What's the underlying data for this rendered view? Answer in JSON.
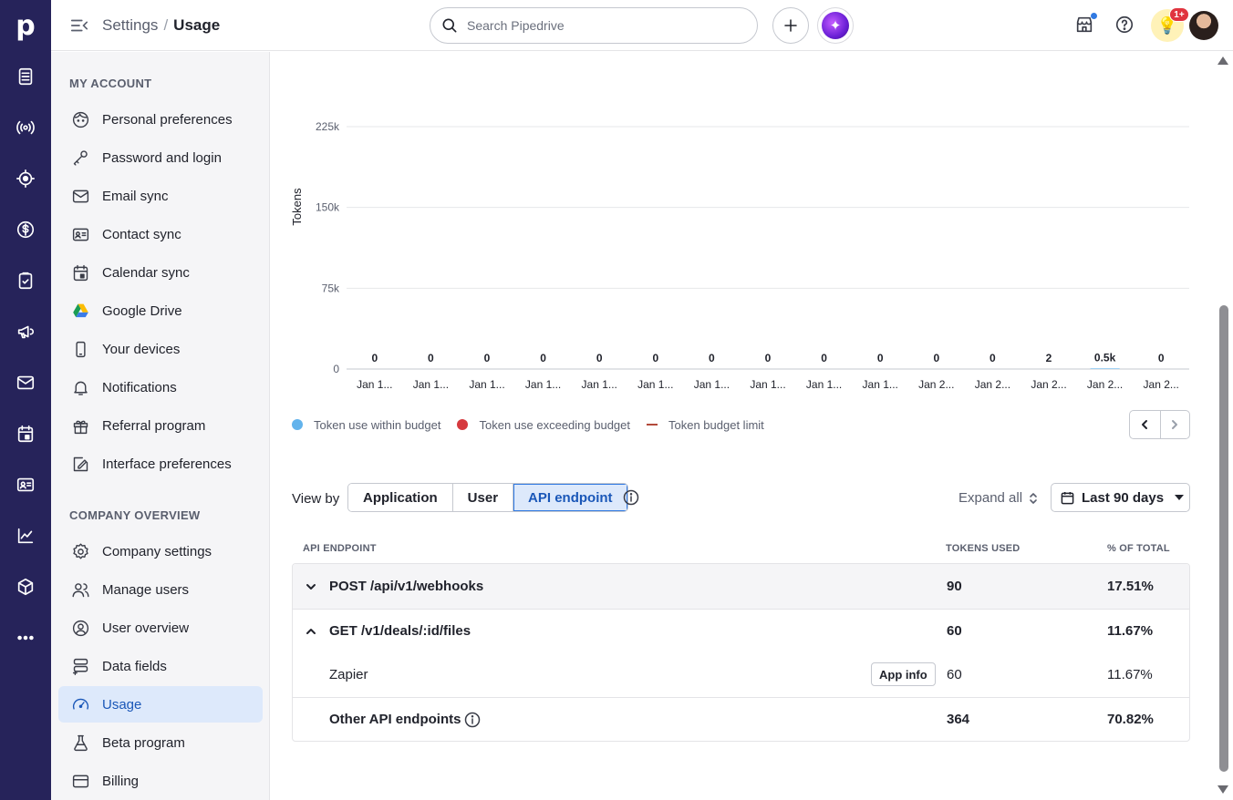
{
  "header": {
    "breadcrumb_parent": "Settings",
    "breadcrumb_sep": "/",
    "breadcrumb_current": "Usage",
    "search_placeholder": "Search Pipedrive",
    "notification_badge": "1+"
  },
  "rail": {
    "logo": "p",
    "icons": [
      "leads-icon",
      "broadcast-icon",
      "target-icon",
      "dollar-icon",
      "tasks-icon",
      "megaphone-icon",
      "mail-icon",
      "calendar-icon",
      "contact-card-icon",
      "insights-icon",
      "products-icon",
      "more-icon"
    ]
  },
  "sidebar": {
    "my_account_title": "MY ACCOUNT",
    "my_account": [
      {
        "label": "Personal preferences",
        "icon": "face-icon"
      },
      {
        "label": "Password and login",
        "icon": "key-icon"
      },
      {
        "label": "Email sync",
        "icon": "envelope-icon"
      },
      {
        "label": "Contact sync",
        "icon": "contact-card-icon"
      },
      {
        "label": "Calendar sync",
        "icon": "calendar-icon"
      },
      {
        "label": "Google Drive",
        "icon": "google-drive-icon"
      },
      {
        "label": "Your devices",
        "icon": "phone-icon"
      },
      {
        "label": "Notifications",
        "icon": "bell-icon"
      },
      {
        "label": "Referral program",
        "icon": "gift-icon"
      },
      {
        "label": "Interface preferences",
        "icon": "interface-icon"
      }
    ],
    "company_title": "COMPANY OVERVIEW",
    "company": [
      {
        "label": "Company settings",
        "icon": "gear-icon"
      },
      {
        "label": "Manage users",
        "icon": "users-icon"
      },
      {
        "label": "User overview",
        "icon": "user-circle-icon"
      },
      {
        "label": "Data fields",
        "icon": "data-fields-icon"
      },
      {
        "label": "Usage",
        "icon": "gauge-icon",
        "active": true
      },
      {
        "label": "Beta program",
        "icon": "flask-icon"
      },
      {
        "label": "Billing",
        "icon": "credit-card-icon"
      }
    ]
  },
  "chart_data": {
    "type": "bar",
    "ylabel": "Tokens",
    "ylim": [
      0,
      225000
    ],
    "yticks": [
      0,
      75000,
      150000,
      225000
    ],
    "ytick_labels": [
      "0",
      "75k",
      "150k",
      "225k"
    ],
    "categories": [
      "Jan 1...",
      "Jan 1...",
      "Jan 1...",
      "Jan 1...",
      "Jan 1...",
      "Jan 1...",
      "Jan 1...",
      "Jan 1...",
      "Jan 1...",
      "Jan 1...",
      "Jan 2...",
      "Jan 2...",
      "Jan 2...",
      "Jan 2...",
      "Jan 2..."
    ],
    "values": [
      0,
      0,
      0,
      0,
      0,
      0,
      0,
      0,
      0,
      0,
      0,
      0,
      2,
      500,
      0
    ],
    "value_labels": [
      "0",
      "0",
      "0",
      "0",
      "0",
      "0",
      "0",
      "0",
      "0",
      "0",
      "0",
      "0",
      "2",
      "0.5k",
      "0"
    ],
    "grid": true,
    "legend": [
      {
        "name": "Token use within budget",
        "color": "#62b3ec",
        "kind": "dot"
      },
      {
        "name": "Token use exceeding budget",
        "color": "#d6393e",
        "kind": "dot"
      },
      {
        "name": "Token budget limit",
        "color": "#b34a3b",
        "kind": "line"
      }
    ]
  },
  "controls": {
    "view_by_label": "View by",
    "tabs": [
      "Application",
      "User",
      "API endpoint"
    ],
    "active_tab": "API endpoint",
    "expand_all": "Expand all",
    "date_range": "Last 90 days"
  },
  "table": {
    "headers": {
      "endpoint": "API ENDPOINT",
      "tokens": "TOKENS USED",
      "pct": "% OF TOTAL"
    },
    "rows": [
      {
        "name": "POST /api/v1/webhooks",
        "tokens": "90",
        "pct": "17.51%",
        "expanded": false
      },
      {
        "name": "GET /v1/deals/:id/files",
        "tokens": "60",
        "pct": "11.67%",
        "expanded": true
      },
      {
        "name": "Zapier",
        "tokens": "60",
        "pct": "11.67%",
        "button": "App info"
      },
      {
        "name": "Other API endpoints",
        "tokens": "364",
        "pct": "70.82%"
      }
    ]
  }
}
